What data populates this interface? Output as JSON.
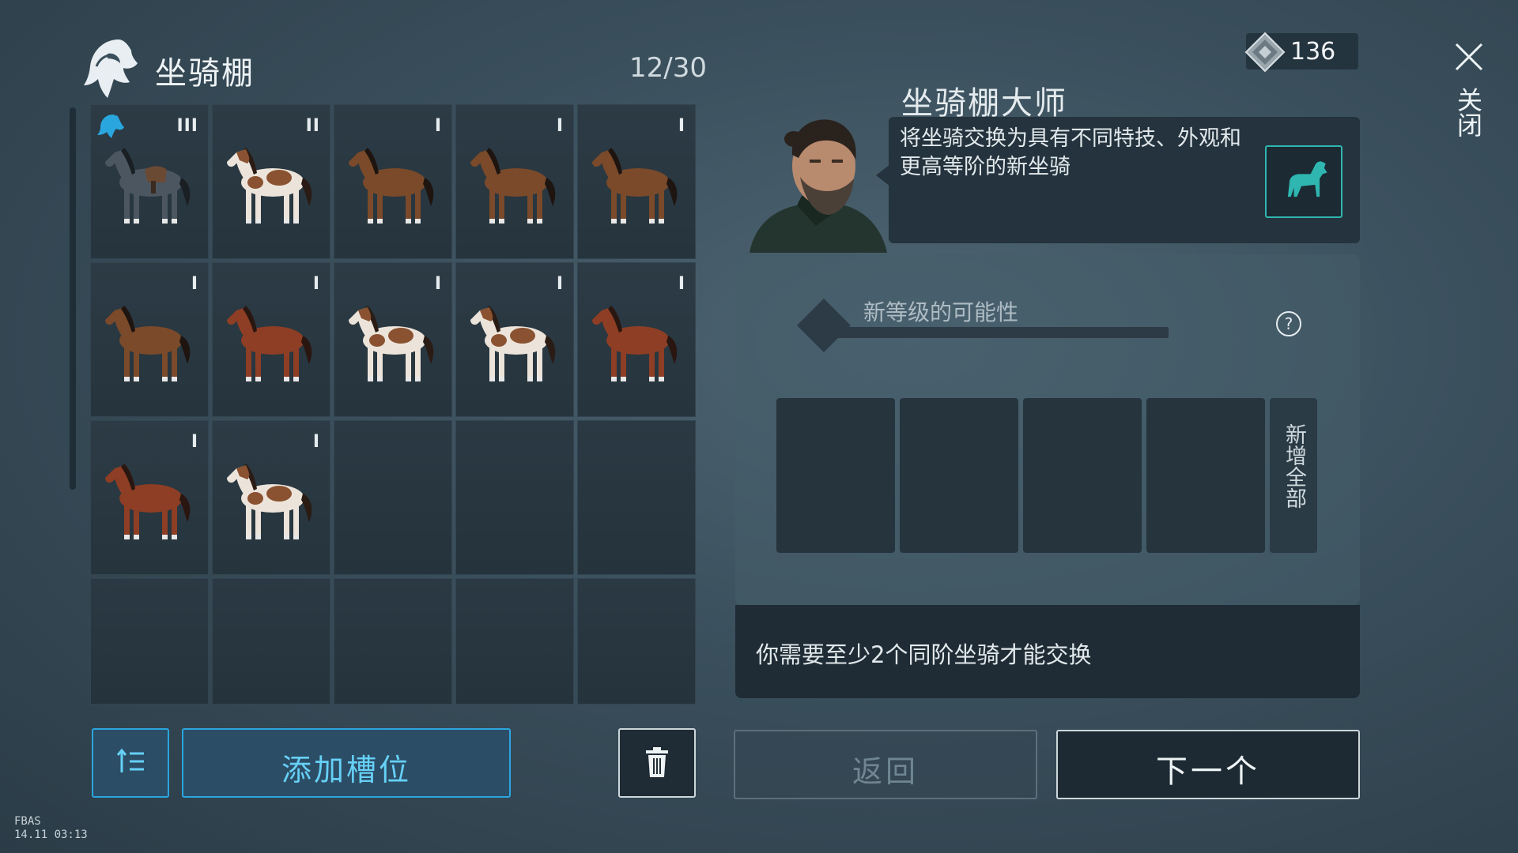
{
  "header": {
    "title": "坐骑棚",
    "slot_count": "12/30"
  },
  "currency": {
    "icon": "diamond-gem-icon",
    "amount": "136"
  },
  "close": {
    "icon": "close-icon",
    "label": "关闭"
  },
  "mounts": [
    {
      "tier": "III",
      "coat": "grey-saddled",
      "equipped": true
    },
    {
      "tier": "II",
      "coat": "pinto",
      "equipped": false
    },
    {
      "tier": "I",
      "coat": "bay",
      "equipped": false
    },
    {
      "tier": "I",
      "coat": "bay",
      "equipped": false
    },
    {
      "tier": "I",
      "coat": "bay",
      "equipped": false
    },
    {
      "tier": "I",
      "coat": "bay",
      "equipped": false
    },
    {
      "tier": "I",
      "coat": "chestnut",
      "equipped": false
    },
    {
      "tier": "I",
      "coat": "pinto",
      "equipped": false
    },
    {
      "tier": "I",
      "coat": "pinto",
      "equipped": false
    },
    {
      "tier": "I",
      "coat": "chestnut",
      "equipped": false
    },
    {
      "tier": "I",
      "coat": "chestnut",
      "equipped": false
    },
    {
      "tier": "I",
      "coat": "pinto",
      "equipped": false
    }
  ],
  "master": {
    "name": "坐骑棚大师",
    "description": "将坐骑交换为具有不同特技、外观和更高等阶的新坐骑"
  },
  "exchange": {
    "tier_label": "新等级的可能性",
    "help_icon": "?",
    "add_all_label": "新增全部",
    "notice": "你需要至少2个同阶坐骑才能交换"
  },
  "buttons": {
    "add_slot": "添加槽位",
    "back": "返回",
    "next": "下一个"
  },
  "build_tag": {
    "line1": "FBAS",
    "line2": "14.11 03:13"
  },
  "colors": {
    "accent_blue": "#2aa6de",
    "teal": "#2fb6b0",
    "bay": "#7a4a2a",
    "chestnut": "#8e3e24",
    "pinto_brown": "#8a5231",
    "grey": "#4c5660"
  }
}
